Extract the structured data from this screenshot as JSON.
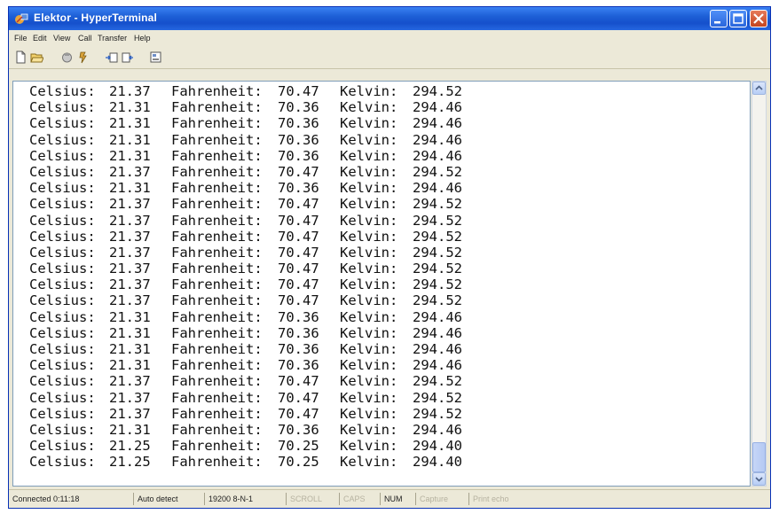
{
  "window": {
    "title": "Elektor - HyperTerminal",
    "controls": {
      "minimize": "minimize",
      "maximize": "maximize",
      "close": "close"
    }
  },
  "menu": {
    "items": [
      "File",
      "Edit",
      "View",
      "Call",
      "Transfer",
      "Help"
    ]
  },
  "toolbar": {
    "icons": [
      "new-icon",
      "open-icon",
      "connect-icon",
      "disconnect-icon",
      "send-icon",
      "receive-icon",
      "properties-icon"
    ]
  },
  "terminal": {
    "lines": [
      {
        "c_label": "Celsius:",
        "c": "21.37",
        "f_label": "Fahrenheit:",
        "f": "70.47",
        "k_label": "Kelvin:",
        "k": "294.52"
      },
      {
        "c_label": "Celsius:",
        "c": "21.31",
        "f_label": "Fahrenheit:",
        "f": "70.36",
        "k_label": "Kelvin:",
        "k": "294.46"
      },
      {
        "c_label": "Celsius:",
        "c": "21.31",
        "f_label": "Fahrenheit:",
        "f": "70.36",
        "k_label": "Kelvin:",
        "k": "294.46"
      },
      {
        "c_label": "Celsius:",
        "c": "21.31",
        "f_label": "Fahrenheit:",
        "f": "70.36",
        "k_label": "Kelvin:",
        "k": "294.46"
      },
      {
        "c_label": "Celsius:",
        "c": "21.31",
        "f_label": "Fahrenheit:",
        "f": "70.36",
        "k_label": "Kelvin:",
        "k": "294.46"
      },
      {
        "c_label": "Celsius:",
        "c": "21.37",
        "f_label": "Fahrenheit:",
        "f": "70.47",
        "k_label": "Kelvin:",
        "k": "294.52"
      },
      {
        "c_label": "Celsius:",
        "c": "21.31",
        "f_label": "Fahrenheit:",
        "f": "70.36",
        "k_label": "Kelvin:",
        "k": "294.46"
      },
      {
        "c_label": "Celsius:",
        "c": "21.37",
        "f_label": "Fahrenheit:",
        "f": "70.47",
        "k_label": "Kelvin:",
        "k": "294.52"
      },
      {
        "c_label": "Celsius:",
        "c": "21.37",
        "f_label": "Fahrenheit:",
        "f": "70.47",
        "k_label": "Kelvin:",
        "k": "294.52"
      },
      {
        "c_label": "Celsius:",
        "c": "21.37",
        "f_label": "Fahrenheit:",
        "f": "70.47",
        "k_label": "Kelvin:",
        "k": "294.52"
      },
      {
        "c_label": "Celsius:",
        "c": "21.37",
        "f_label": "Fahrenheit:",
        "f": "70.47",
        "k_label": "Kelvin:",
        "k": "294.52"
      },
      {
        "c_label": "Celsius:",
        "c": "21.37",
        "f_label": "Fahrenheit:",
        "f": "70.47",
        "k_label": "Kelvin:",
        "k": "294.52"
      },
      {
        "c_label": "Celsius:",
        "c": "21.37",
        "f_label": "Fahrenheit:",
        "f": "70.47",
        "k_label": "Kelvin:",
        "k": "294.52"
      },
      {
        "c_label": "Celsius:",
        "c": "21.37",
        "f_label": "Fahrenheit:",
        "f": "70.47",
        "k_label": "Kelvin:",
        "k": "294.52"
      },
      {
        "c_label": "Celsius:",
        "c": "21.31",
        "f_label": "Fahrenheit:",
        "f": "70.36",
        "k_label": "Kelvin:",
        "k": "294.46"
      },
      {
        "c_label": "Celsius:",
        "c": "21.31",
        "f_label": "Fahrenheit:",
        "f": "70.36",
        "k_label": "Kelvin:",
        "k": "294.46"
      },
      {
        "c_label": "Celsius:",
        "c": "21.31",
        "f_label": "Fahrenheit:",
        "f": "70.36",
        "k_label": "Kelvin:",
        "k": "294.46"
      },
      {
        "c_label": "Celsius:",
        "c": "21.31",
        "f_label": "Fahrenheit:",
        "f": "70.36",
        "k_label": "Kelvin:",
        "k": "294.46"
      },
      {
        "c_label": "Celsius:",
        "c": "21.37",
        "f_label": "Fahrenheit:",
        "f": "70.47",
        "k_label": "Kelvin:",
        "k": "294.52"
      },
      {
        "c_label": "Celsius:",
        "c": "21.37",
        "f_label": "Fahrenheit:",
        "f": "70.47",
        "k_label": "Kelvin:",
        "k": "294.52"
      },
      {
        "c_label": "Celsius:",
        "c": "21.37",
        "f_label": "Fahrenheit:",
        "f": "70.47",
        "k_label": "Kelvin:",
        "k": "294.52"
      },
      {
        "c_label": "Celsius:",
        "c": "21.31",
        "f_label": "Fahrenheit:",
        "f": "70.36",
        "k_label": "Kelvin:",
        "k": "294.46"
      },
      {
        "c_label": "Celsius:",
        "c": "21.25",
        "f_label": "Fahrenheit:",
        "f": "70.25",
        "k_label": "Kelvin:",
        "k": "294.40"
      },
      {
        "c_label": "Celsius:",
        "c": "21.25",
        "f_label": "Fahrenheit:",
        "f": "70.25",
        "k_label": "Kelvin:",
        "k": "294.40"
      }
    ]
  },
  "status": {
    "connected": "Connected 0:11:18",
    "detect": "Auto detect",
    "settings": "19200 8-N-1",
    "scroll": "SCROLL",
    "caps": "CAPS",
    "num": "NUM",
    "capture": "Capture",
    "print_echo": "Print echo"
  },
  "colors": {
    "title_bar": "#1d5fd6",
    "chrome": "#ece9d8",
    "terminal_bg": "#ffffff",
    "terminal_text": "#111111"
  }
}
